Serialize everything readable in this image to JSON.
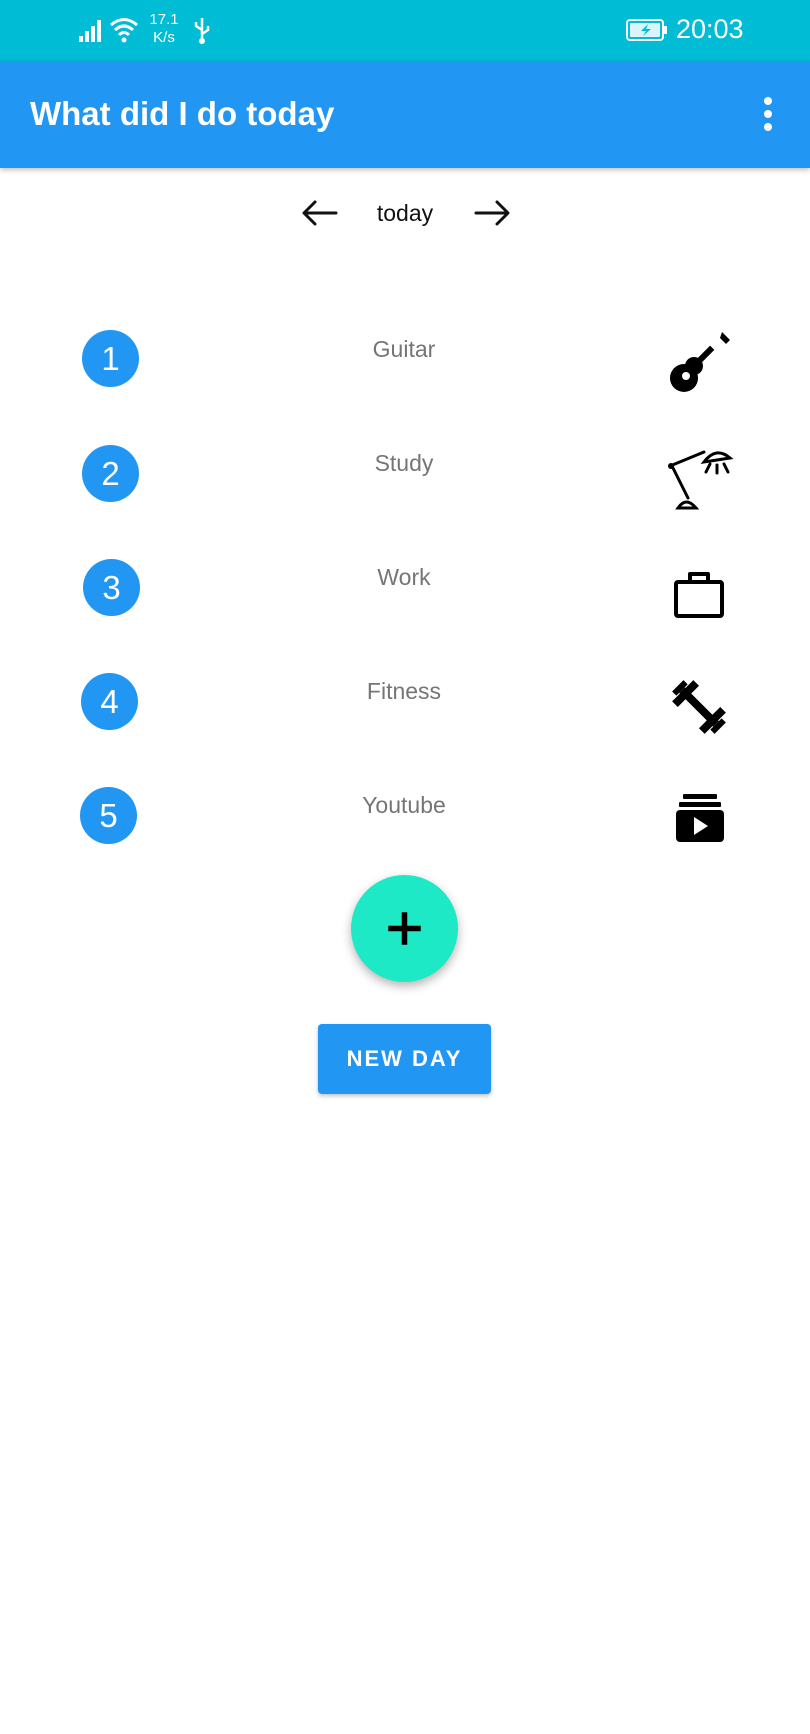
{
  "status_bar": {
    "network_speed_value": "17.1",
    "network_speed_unit": "K/s",
    "time": "20:03",
    "icons": [
      "signal-icon",
      "wifi-icon",
      "usb-icon",
      "battery-charging-icon"
    ]
  },
  "app_bar": {
    "title": "What did I do today",
    "overflow_icon": "more-vert-icon"
  },
  "day_nav": {
    "prev_icon": "arrow-left-icon",
    "label": "today",
    "next_icon": "arrow-right-icon"
  },
  "activities": [
    {
      "number": "1",
      "name": "Guitar",
      "icon": "guitar-icon"
    },
    {
      "number": "2",
      "name": "Study",
      "icon": "desk-lamp-icon"
    },
    {
      "number": "3",
      "name": "Work",
      "icon": "briefcase-icon"
    },
    {
      "number": "4",
      "name": "Fitness",
      "icon": "dumbbell-icon"
    },
    {
      "number": "5",
      "name": "Youtube",
      "icon": "video-library-icon"
    }
  ],
  "fab": {
    "icon": "plus-icon"
  },
  "new_day_button": {
    "label": "NEW DAY"
  },
  "colors": {
    "status_bar": "#00BCD4",
    "app_bar": "#2196F3",
    "number_circle": "#2196F3",
    "fab": "#1DE9C6",
    "button": "#2196F3",
    "activity_text": "#757575"
  }
}
